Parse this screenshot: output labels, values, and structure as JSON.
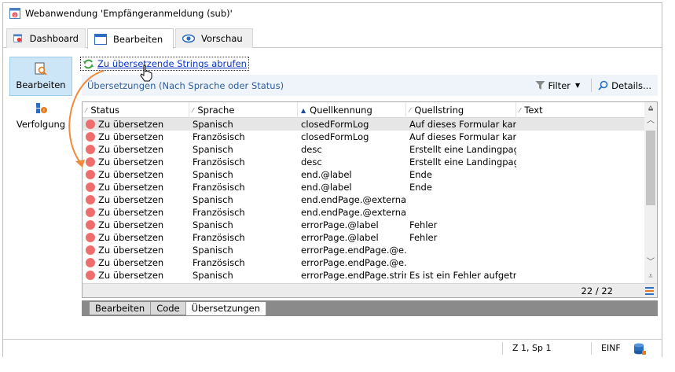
{
  "window": {
    "title": "Webanwendung 'Empfängeranmeldung (sub)'"
  },
  "tabs": [
    {
      "label": "Dashboard",
      "icon": "dashboard-icon",
      "active": false
    },
    {
      "label": "Bearbeiten",
      "icon": "edit-window-icon",
      "active": true
    },
    {
      "label": "Vorschau",
      "icon": "eye-icon",
      "active": false
    }
  ],
  "sidebar": {
    "items": [
      {
        "label": "Bearbeiten",
        "icon": "search-page-icon",
        "active": true
      },
      {
        "label": "Verfolgung",
        "icon": "tracking-icon",
        "active": false
      }
    ]
  },
  "actions": {
    "fetch_strings_label": "Zu übersetzende Strings abrufen"
  },
  "list": {
    "title": "Übersetzungen (Nach Sprache oder Status)",
    "filter_label": "Filter",
    "details_label": "Details...",
    "columns": [
      "Status",
      "Sprache",
      "Quellkennung",
      "Quellstring",
      "Text"
    ],
    "rows": [
      [
        "Zu übersetzen",
        "Spanisch",
        "closedFormLog",
        "Auf dieses Formular kann.",
        ""
      ],
      [
        "Zu übersetzen",
        "Französisch",
        "closedFormLog",
        "Auf dieses Formular kann.",
        ""
      ],
      [
        "Zu übersetzen",
        "Spanisch",
        "desc",
        "Erstellt eine Landingpage.",
        ""
      ],
      [
        "Zu übersetzen",
        "Französisch",
        "desc",
        "Erstellt eine Landingpage.",
        ""
      ],
      [
        "Zu übersetzen",
        "Spanisch",
        "end.@label",
        "Ende",
        ""
      ],
      [
        "Zu übersetzen",
        "Französisch",
        "end.@label",
        "Ende",
        ""
      ],
      [
        "Zu übersetzen",
        "Spanisch",
        "end.endPage.@externalU.",
        "",
        ""
      ],
      [
        "Zu übersetzen",
        "Französisch",
        "end.endPage.@externalU.",
        "",
        ""
      ],
      [
        "Zu übersetzen",
        "Spanisch",
        "errorPage.@label",
        "Fehler",
        ""
      ],
      [
        "Zu übersetzen",
        "Französisch",
        "errorPage.@label",
        "Fehler",
        ""
      ],
      [
        "Zu übersetzen",
        "Spanisch",
        "errorPage.endPage.@e...",
        "",
        ""
      ],
      [
        "Zu übersetzen",
        "Französisch",
        "errorPage.endPage.@e...",
        "",
        ""
      ],
      [
        "Zu übersetzen",
        "Spanisch",
        "errorPage.endPage.strin...",
        "Es ist ein Fehler aufgetre...",
        ""
      ]
    ],
    "count": "22 / 22",
    "status_color": "#ee6e6e",
    "selected_color": "#e6e6e6"
  },
  "bottom_tabs": [
    {
      "label": "Bearbeiten",
      "active": false
    },
    {
      "label": "Code",
      "active": false
    },
    {
      "label": "Übersetzungen",
      "active": true
    }
  ],
  "statusbar": {
    "position": "Z 1, Sp 1",
    "mode": "EINF"
  },
  "colors": {
    "accent": "#f08a3c",
    "link": "#0a35c6",
    "header_bg": "#eef4fa",
    "sidebar_active": "#cde6f7"
  }
}
